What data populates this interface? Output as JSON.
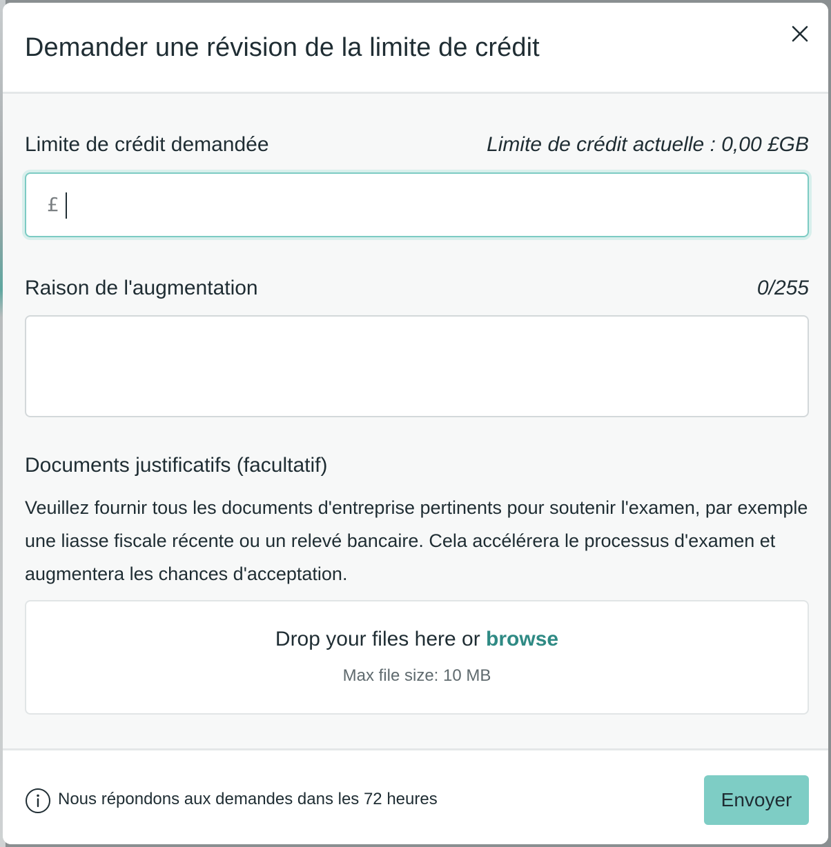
{
  "modal": {
    "title": "Demander une révision de la limite de crédit",
    "close_icon": "close-icon"
  },
  "credit_limit": {
    "label": "Limite de crédit demandée",
    "current_limit": "Limite de crédit actuelle : 0,00 £GB",
    "currency_symbol": "£",
    "value": ""
  },
  "reason": {
    "label": "Raison de l'augmentation",
    "counter": "0/255",
    "value": ""
  },
  "documents": {
    "title": "Documents justificatifs (facultatif)",
    "description": "Veuillez fournir tous les documents d'entreprise pertinents pour soutenir l'examen, par exemple une liasse fiscale récente ou un relevé bancaire. Cela accélérera le processus d'examen et augmentera les chances d'acceptation.",
    "dropzone_text": "Drop your files here or",
    "browse_label": "browse",
    "max_size": "Max file size: 10 MB"
  },
  "footer": {
    "info_icon": "info-icon",
    "note": "Nous répondons aux demandes dans les 72 heures",
    "submit_label": "Envoyer"
  },
  "colors": {
    "accent": "#7ecdc5",
    "link": "#2f8a84",
    "focus_border": "#7ccbc3",
    "text": "#1f2d33"
  }
}
